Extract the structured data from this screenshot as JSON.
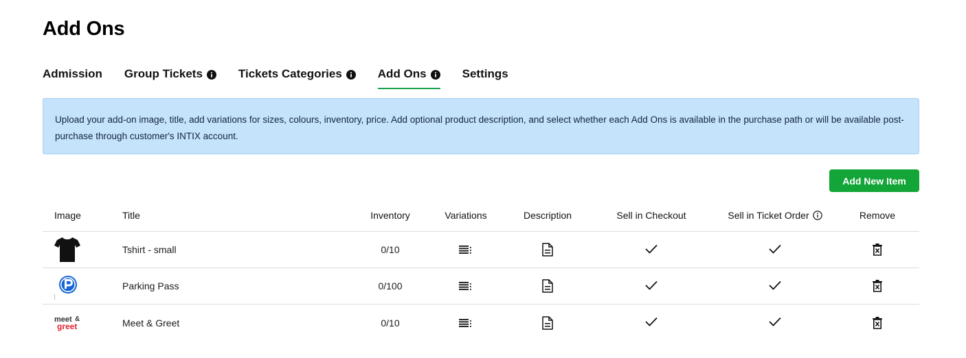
{
  "page": {
    "title": "Add Ons"
  },
  "tabs": [
    {
      "label": "Admission",
      "info": false,
      "active": false
    },
    {
      "label": "Group Tickets",
      "info": true,
      "active": false
    },
    {
      "label": "Tickets Categories",
      "info": true,
      "active": false
    },
    {
      "label": "Add Ons",
      "info": true,
      "active": true
    },
    {
      "label": "Settings",
      "info": false,
      "active": false
    }
  ],
  "banner": {
    "text": "Upload your add-on image, title, add variations for sizes, colours, inventory, price. Add optional product description, and select whether each Add Ons is available in the purchase path or will be available post-purchase through customer's INTIX account."
  },
  "actions": {
    "add_new_label": "Add New Item"
  },
  "table": {
    "headers": {
      "image": "Image",
      "title": "Title",
      "inventory": "Inventory",
      "variations": "Variations",
      "description": "Description",
      "sell_checkout": "Sell in Checkout",
      "sell_ticket_order": "Sell in Ticket Order",
      "remove": "Remove"
    },
    "rows": [
      {
        "image": "tshirt-image",
        "title": "Tshirt - small",
        "inventory": "0/10",
        "sell_checkout": true,
        "sell_ticket_order": true
      },
      {
        "image": "parking-image",
        "title": "Parking Pass",
        "inventory": "0/100",
        "sell_checkout": true,
        "sell_ticket_order": true
      },
      {
        "image": "meet-greet-image",
        "image_text_top": "meet",
        "image_text_amp": "&",
        "image_text_bottom": "greet",
        "title": "Meet & Greet",
        "inventory": "0/10",
        "sell_checkout": true,
        "sell_ticket_order": true
      }
    ]
  },
  "colors": {
    "accent": "#16a34a",
    "button": "#13a538",
    "banner_bg": "#c5e3fb",
    "parking_blue": "#1565d8",
    "meet_red": "#e0242f"
  },
  "icons": [
    "info-icon",
    "list-icon",
    "document-icon",
    "check-icon",
    "trash-icon"
  ]
}
